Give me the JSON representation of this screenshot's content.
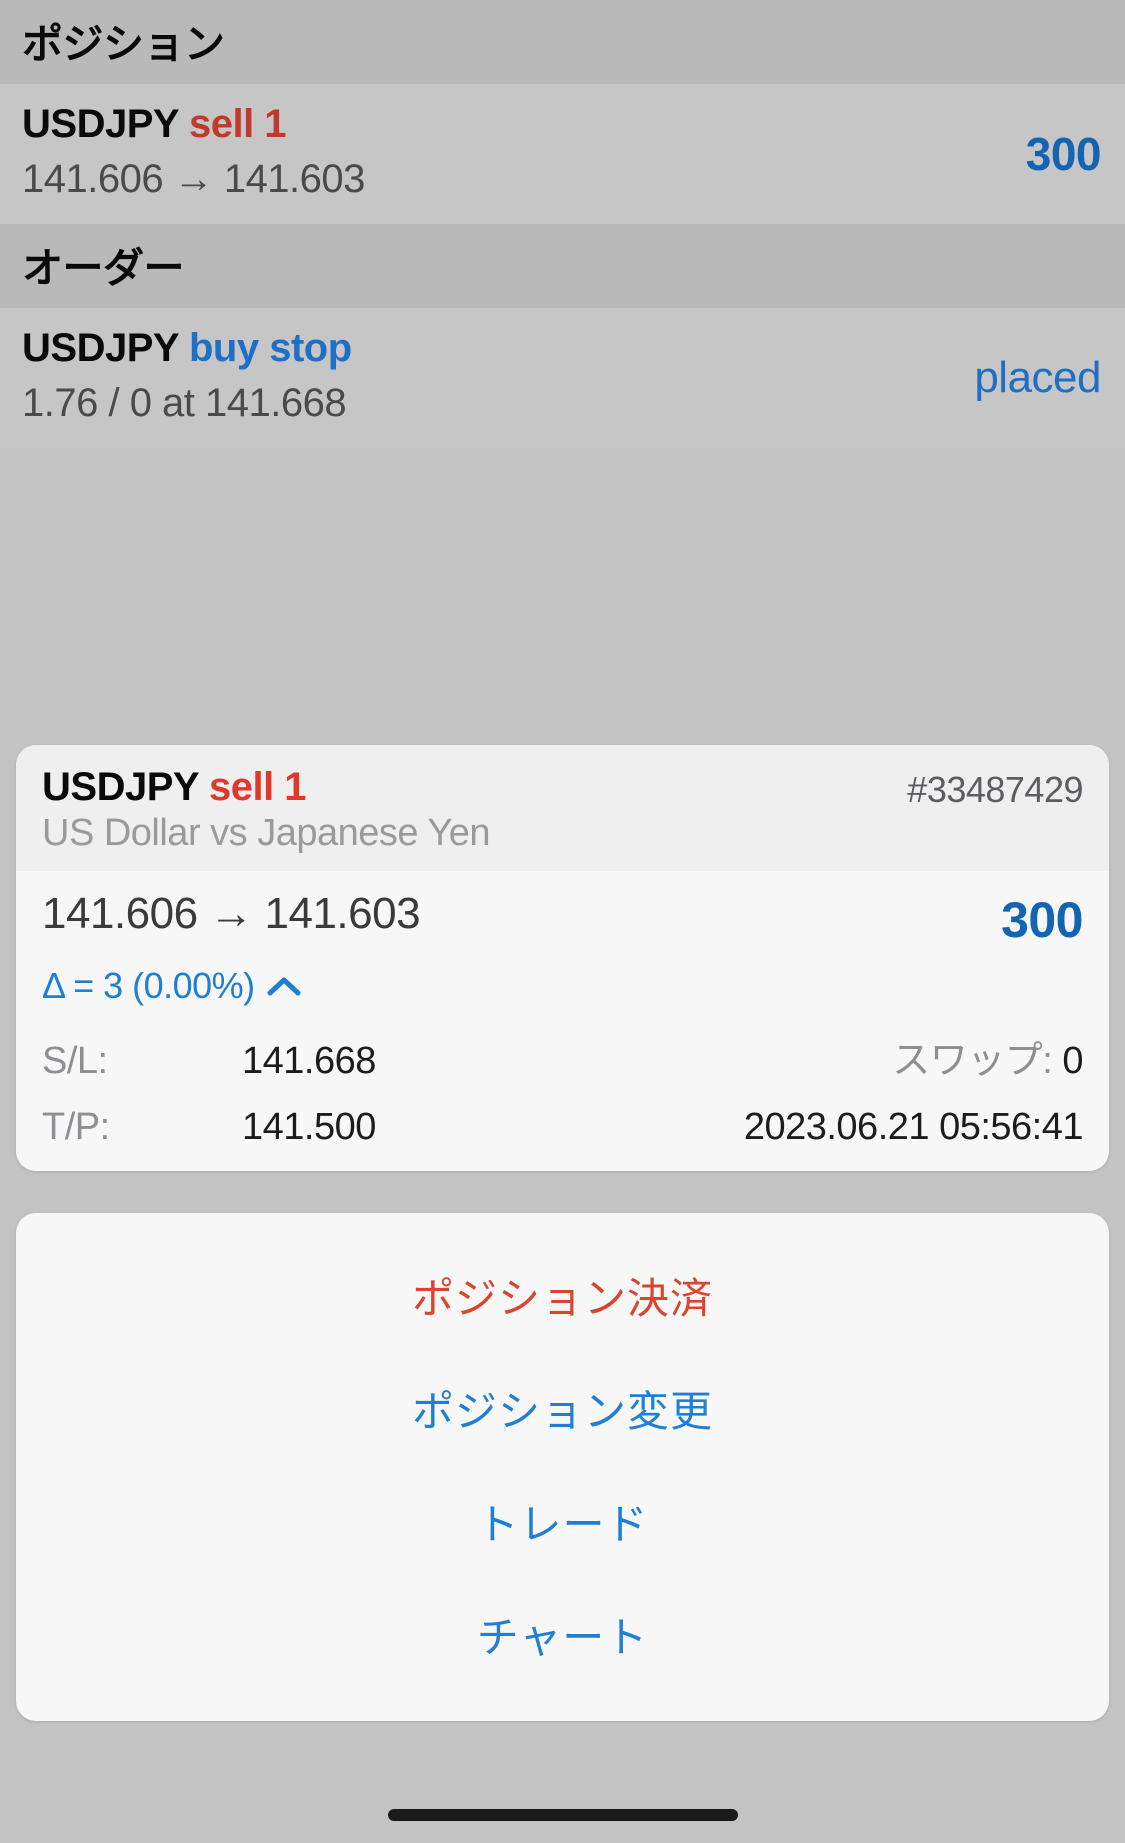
{
  "sections": [
    {
      "header": "ポジション",
      "rows": [
        {
          "symbol": "USDJPY",
          "side": "sell 1",
          "side_type": "sell",
          "detail": "141.606 → 141.603",
          "value": "300",
          "value_type": "profit"
        }
      ]
    },
    {
      "header": "オーダー",
      "rows": [
        {
          "symbol": "USDJPY",
          "side": "buy stop",
          "side_type": "buy",
          "detail": "1.76 / 0 at 141.668",
          "value": "placed",
          "value_type": "status"
        }
      ]
    }
  ],
  "detail_card": {
    "symbol": "USDJPY",
    "side": "sell 1",
    "ticket": "#33487429",
    "instrument_name": "US Dollar vs Japanese Yen",
    "price_open": "141.606",
    "price_arrow": "→",
    "price_current": "141.603",
    "price_text": "141.606 → 141.603",
    "profit": "300",
    "delta": "Δ = 3 (0.00%)",
    "delta_icon": "chevron-up-icon",
    "sl_label": "S/L:",
    "sl_value": "141.668",
    "tp_label": "T/P:",
    "tp_value": "141.500",
    "swap_label": "スワップ:",
    "swap_value": "0",
    "swap_text": "スワップ: 0",
    "timestamp": "2023.06.21 05:56:41"
  },
  "action_sheet": {
    "items": [
      {
        "label": "ポジション決済",
        "style": "destructive",
        "name": "close-position"
      },
      {
        "label": "ポジション変更",
        "style": "default",
        "name": "modify-position"
      },
      {
        "label": "トレード",
        "style": "default",
        "name": "trade"
      },
      {
        "label": "チャート",
        "style": "default",
        "name": "chart"
      }
    ]
  },
  "colors": {
    "accent_blue": "#1f7fd4",
    "profit_blue": "#1464b4",
    "sell_red": "#c0392b",
    "destructive_red": "#d9452f",
    "background": "#c3c3c3"
  }
}
